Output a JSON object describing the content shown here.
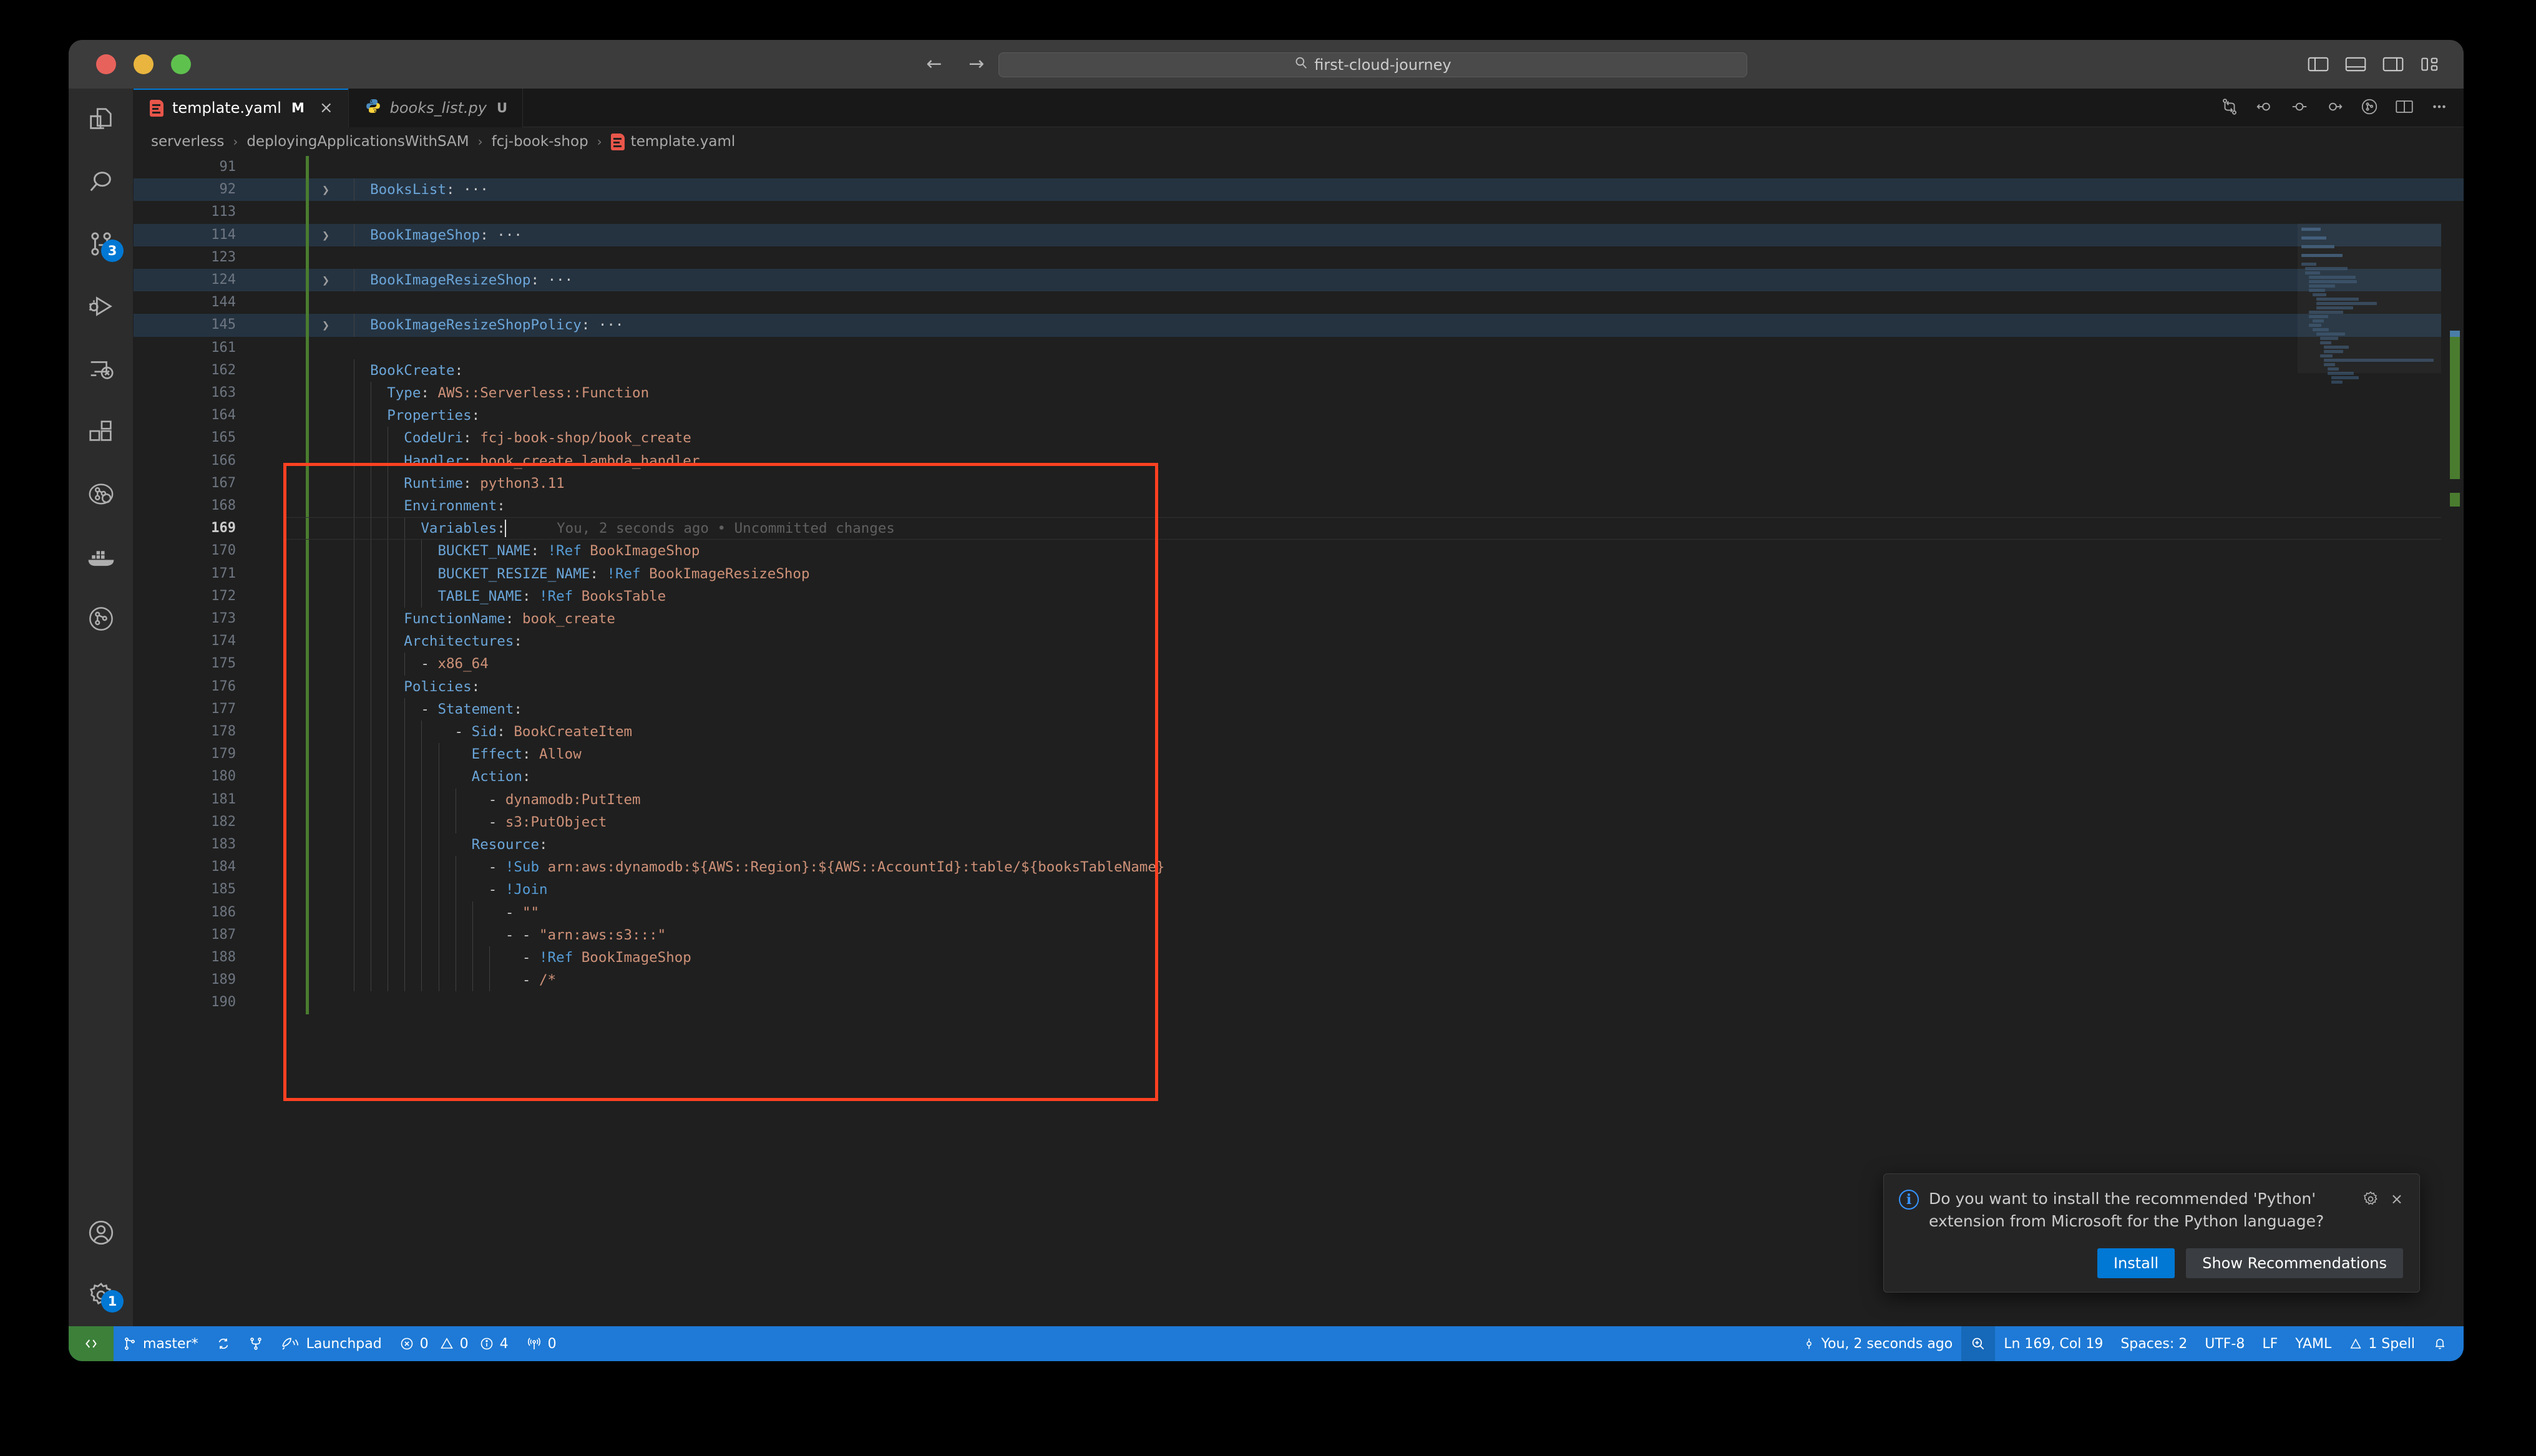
{
  "window": {
    "traffic_lights": [
      "close",
      "minimize",
      "maximize"
    ]
  },
  "titlebar": {
    "back_arrow": "←",
    "forward_arrow": "→",
    "search_icon": "⚲",
    "search_value": "first-cloud-journey",
    "layout_icons": [
      "toggle-primary-sidebar",
      "toggle-panel",
      "toggle-secondary-sidebar",
      "customize-layout"
    ]
  },
  "activitybar": {
    "items": [
      {
        "name": "explorer",
        "icon": "files-icon",
        "badge": ""
      },
      {
        "name": "search",
        "icon": "search-icon",
        "badge": ""
      },
      {
        "name": "source-control",
        "icon": "source-control-icon",
        "badge": "3"
      },
      {
        "name": "run-and-debug",
        "icon": "run-debug-icon",
        "badge": ""
      },
      {
        "name": "remote-explorer",
        "icon": "remote-explorer-icon",
        "badge": ""
      },
      {
        "name": "extensions",
        "icon": "extensions-icon",
        "badge": ""
      },
      {
        "name": "aws-toolkit",
        "icon": "aws-toolkit-icon",
        "badge": ""
      },
      {
        "name": "docker",
        "icon": "docker-icon",
        "badge": ""
      },
      {
        "name": "gitlens",
        "icon": "gitlens-icon",
        "badge": ""
      }
    ],
    "bottom_items": [
      {
        "name": "accounts",
        "icon": "account-icon",
        "badge": ""
      },
      {
        "name": "manage",
        "icon": "gear-icon",
        "badge": "1"
      }
    ]
  },
  "tabs": [
    {
      "label": "template.yaml",
      "state": "M",
      "icon": "yaml-file-icon",
      "active": true,
      "closable": true
    },
    {
      "label": "books_list.py",
      "state": "U",
      "icon": "python-file-icon",
      "active": false,
      "closable": false
    }
  ],
  "tab_actions": [
    "compare-changes-icon",
    "previous-change-icon",
    "toggle-change-icon",
    "next-change-icon",
    "gitlens-inspect-icon",
    "split-editor-icon",
    "more-actions-icon"
  ],
  "breadcrumb": {
    "separator": "›",
    "items": [
      {
        "label": "serverless"
      },
      {
        "label": "deployingApplicationsWithSAM"
      },
      {
        "label": "fcj-book-shop"
      },
      {
        "label": "template.yaml",
        "icon": "yaml-file-icon"
      }
    ]
  },
  "editor": {
    "blame_text": "You, 2 seconds ago • Uncommitted changes",
    "lines": [
      {
        "num": "91",
        "folded": false,
        "highlight": false,
        "indent": 0,
        "tokens": []
      },
      {
        "num": "92",
        "folded": true,
        "highlight": true,
        "indent": 1,
        "tokens": [
          {
            "t": "  ",
            "c": "p"
          },
          {
            "t": "BooksList",
            "c": "k"
          },
          {
            "t": ":",
            "c": "p"
          },
          {
            "t": " ···",
            "c": "p"
          }
        ]
      },
      {
        "num": "113",
        "folded": false,
        "highlight": false,
        "indent": 0,
        "tokens": []
      },
      {
        "num": "114",
        "folded": true,
        "highlight": true,
        "indent": 1,
        "tokens": [
          {
            "t": "  ",
            "c": "p"
          },
          {
            "t": "BookImageShop",
            "c": "k"
          },
          {
            "t": ":",
            "c": "p"
          },
          {
            "t": " ···",
            "c": "p"
          }
        ]
      },
      {
        "num": "123",
        "folded": false,
        "highlight": false,
        "indent": 0,
        "tokens": []
      },
      {
        "num": "124",
        "folded": true,
        "highlight": true,
        "indent": 1,
        "tokens": [
          {
            "t": "  ",
            "c": "p"
          },
          {
            "t": "BookImageResizeShop",
            "c": "k"
          },
          {
            "t": ":",
            "c": "p"
          },
          {
            "t": " ···",
            "c": "p"
          }
        ]
      },
      {
        "num": "144",
        "folded": false,
        "highlight": false,
        "indent": 0,
        "tokens": []
      },
      {
        "num": "145",
        "folded": true,
        "highlight": true,
        "indent": 1,
        "tokens": [
          {
            "t": "  ",
            "c": "p"
          },
          {
            "t": "BookImageResizeShopPolicy",
            "c": "k"
          },
          {
            "t": ":",
            "c": "p"
          },
          {
            "t": " ···",
            "c": "p"
          }
        ]
      },
      {
        "num": "161",
        "folded": false,
        "highlight": false,
        "indent": 0,
        "tokens": []
      },
      {
        "num": "162",
        "folded": false,
        "highlight": false,
        "indent": 1,
        "tokens": [
          {
            "t": "  ",
            "c": "p"
          },
          {
            "t": "BookCreate",
            "c": "k"
          },
          {
            "t": ":",
            "c": "p"
          }
        ]
      },
      {
        "num": "163",
        "folded": false,
        "highlight": false,
        "indent": 2,
        "tokens": [
          {
            "t": "    ",
            "c": "p"
          },
          {
            "t": "Type",
            "c": "k"
          },
          {
            "t": ": ",
            "c": "p"
          },
          {
            "t": "AWS::Serverless::Function",
            "c": "v"
          }
        ]
      },
      {
        "num": "164",
        "folded": false,
        "highlight": false,
        "indent": 2,
        "tokens": [
          {
            "t": "    ",
            "c": "p"
          },
          {
            "t": "Properties",
            "c": "k"
          },
          {
            "t": ":",
            "c": "p"
          }
        ]
      },
      {
        "num": "165",
        "folded": false,
        "highlight": false,
        "indent": 3,
        "tokens": [
          {
            "t": "      ",
            "c": "p"
          },
          {
            "t": "CodeUri",
            "c": "k"
          },
          {
            "t": ": ",
            "c": "p"
          },
          {
            "t": "fcj-book-shop/book_create",
            "c": "v"
          }
        ]
      },
      {
        "num": "166",
        "folded": false,
        "highlight": false,
        "indent": 3,
        "tokens": [
          {
            "t": "      ",
            "c": "p"
          },
          {
            "t": "Handler",
            "c": "k"
          },
          {
            "t": ": ",
            "c": "p"
          },
          {
            "t": "book_create.lambda_handler",
            "c": "v"
          }
        ]
      },
      {
        "num": "167",
        "folded": false,
        "highlight": false,
        "indent": 3,
        "tokens": [
          {
            "t": "      ",
            "c": "p"
          },
          {
            "t": "Runtime",
            "c": "k"
          },
          {
            "t": ": ",
            "c": "p"
          },
          {
            "t": "python3.11",
            "c": "v"
          }
        ]
      },
      {
        "num": "168",
        "folded": false,
        "highlight": false,
        "indent": 3,
        "tokens": [
          {
            "t": "      ",
            "c": "p"
          },
          {
            "t": "Environment",
            "c": "k"
          },
          {
            "t": ":",
            "c": "p"
          }
        ]
      },
      {
        "num": "169",
        "folded": false,
        "highlight": false,
        "current": true,
        "indent": 4,
        "tokens": [
          {
            "t": "        ",
            "c": "p"
          },
          {
            "t": "Variables",
            "c": "k"
          },
          {
            "t": ":",
            "c": "p"
          }
        ]
      },
      {
        "num": "170",
        "folded": false,
        "highlight": false,
        "indent": 5,
        "tokens": [
          {
            "t": "          ",
            "c": "p"
          },
          {
            "t": "BUCKET_NAME",
            "c": "k"
          },
          {
            "t": ": ",
            "c": "p"
          },
          {
            "t": "!Ref",
            "c": "tag"
          },
          {
            "t": " BookImageShop",
            "c": "v"
          }
        ]
      },
      {
        "num": "171",
        "folded": false,
        "highlight": false,
        "indent": 5,
        "tokens": [
          {
            "t": "          ",
            "c": "p"
          },
          {
            "t": "BUCKET_RESIZE_NAME",
            "c": "k"
          },
          {
            "t": ": ",
            "c": "p"
          },
          {
            "t": "!Ref",
            "c": "tag"
          },
          {
            "t": " BookImageResizeShop",
            "c": "v"
          }
        ]
      },
      {
        "num": "172",
        "folded": false,
        "highlight": false,
        "indent": 5,
        "tokens": [
          {
            "t": "          ",
            "c": "p"
          },
          {
            "t": "TABLE_NAME",
            "c": "k"
          },
          {
            "t": ": ",
            "c": "p"
          },
          {
            "t": "!Ref",
            "c": "tag"
          },
          {
            "t": " BooksTable",
            "c": "v"
          }
        ]
      },
      {
        "num": "173",
        "folded": false,
        "highlight": false,
        "indent": 3,
        "tokens": [
          {
            "t": "      ",
            "c": "p"
          },
          {
            "t": "FunctionName",
            "c": "k"
          },
          {
            "t": ": ",
            "c": "p"
          },
          {
            "t": "book_create",
            "c": "v"
          }
        ]
      },
      {
        "num": "174",
        "folded": false,
        "highlight": false,
        "indent": 3,
        "tokens": [
          {
            "t": "      ",
            "c": "p"
          },
          {
            "t": "Architectures",
            "c": "k"
          },
          {
            "t": ":",
            "c": "p"
          }
        ]
      },
      {
        "num": "175",
        "folded": false,
        "highlight": false,
        "indent": 4,
        "tokens": [
          {
            "t": "        - ",
            "c": "dash"
          },
          {
            "t": "x86_64",
            "c": "v"
          }
        ]
      },
      {
        "num": "176",
        "folded": false,
        "highlight": false,
        "indent": 3,
        "tokens": [
          {
            "t": "      ",
            "c": "p"
          },
          {
            "t": "Policies",
            "c": "k"
          },
          {
            "t": ":",
            "c": "p"
          }
        ]
      },
      {
        "num": "177",
        "folded": false,
        "highlight": false,
        "indent": 4,
        "tokens": [
          {
            "t": "        - ",
            "c": "dash"
          },
          {
            "t": "Statement",
            "c": "k"
          },
          {
            "t": ":",
            "c": "p"
          }
        ]
      },
      {
        "num": "178",
        "folded": false,
        "highlight": false,
        "indent": 5,
        "tokens": [
          {
            "t": "            - ",
            "c": "dash"
          },
          {
            "t": "Sid",
            "c": "k"
          },
          {
            "t": ": ",
            "c": "p"
          },
          {
            "t": "BookCreateItem",
            "c": "v"
          }
        ]
      },
      {
        "num": "179",
        "folded": false,
        "highlight": false,
        "indent": 6,
        "tokens": [
          {
            "t": "              ",
            "c": "p"
          },
          {
            "t": "Effect",
            "c": "k"
          },
          {
            "t": ": ",
            "c": "p"
          },
          {
            "t": "Allow",
            "c": "v"
          }
        ]
      },
      {
        "num": "180",
        "folded": false,
        "highlight": false,
        "indent": 6,
        "tokens": [
          {
            "t": "              ",
            "c": "p"
          },
          {
            "t": "Action",
            "c": "k"
          },
          {
            "t": ":",
            "c": "p"
          }
        ]
      },
      {
        "num": "181",
        "folded": false,
        "highlight": false,
        "indent": 7,
        "tokens": [
          {
            "t": "                - ",
            "c": "dash"
          },
          {
            "t": "dynamodb:PutItem",
            "c": "v"
          }
        ]
      },
      {
        "num": "182",
        "folded": false,
        "highlight": false,
        "indent": 7,
        "tokens": [
          {
            "t": "                - ",
            "c": "dash"
          },
          {
            "t": "s3:PutObject",
            "c": "v"
          }
        ]
      },
      {
        "num": "183",
        "folded": false,
        "highlight": false,
        "indent": 6,
        "tokens": [
          {
            "t": "              ",
            "c": "p"
          },
          {
            "t": "Resource",
            "c": "k"
          },
          {
            "t": ":",
            "c": "p"
          }
        ]
      },
      {
        "num": "184",
        "folded": false,
        "highlight": false,
        "indent": 7,
        "tokens": [
          {
            "t": "                - ",
            "c": "dash"
          },
          {
            "t": "!Sub",
            "c": "tag"
          },
          {
            "t": " arn:aws:dynamodb:${AWS::Region}:${AWS::AccountId}:table/${booksTableName}",
            "c": "v"
          }
        ]
      },
      {
        "num": "185",
        "folded": false,
        "highlight": false,
        "indent": 7,
        "tokens": [
          {
            "t": "                - ",
            "c": "dash"
          },
          {
            "t": "!Join",
            "c": "tag"
          }
        ]
      },
      {
        "num": "186",
        "folded": false,
        "highlight": false,
        "indent": 8,
        "tokens": [
          {
            "t": "                  - ",
            "c": "dash"
          },
          {
            "t": "\"\"",
            "c": "v"
          }
        ]
      },
      {
        "num": "187",
        "folded": false,
        "highlight": false,
        "indent": 8,
        "tokens": [
          {
            "t": "                  - - ",
            "c": "dash"
          },
          {
            "t": "\"arn:aws:s3:::\"",
            "c": "v"
          }
        ]
      },
      {
        "num": "188",
        "folded": false,
        "highlight": false,
        "indent": 9,
        "tokens": [
          {
            "t": "                    - ",
            "c": "dash"
          },
          {
            "t": "!Ref",
            "c": "tag"
          },
          {
            "t": " BookImageShop",
            "c": "v"
          }
        ]
      },
      {
        "num": "189",
        "folded": false,
        "highlight": false,
        "indent": 9,
        "tokens": [
          {
            "t": "                    - ",
            "c": "dash"
          },
          {
            "t": "/*",
            "c": "v"
          }
        ]
      },
      {
        "num": "190",
        "folded": false,
        "highlight": false,
        "indent": 0,
        "tokens": []
      }
    ]
  },
  "annotation": {
    "color": "#fc4122",
    "label": "highlight-box-book-create"
  },
  "toast": {
    "icon": "info-icon",
    "message": "Do you want to install the recommended 'Python' extension from Microsoft for the Python language?",
    "gear_icon": "gear-icon",
    "close_icon": "close-icon",
    "primary_button": "Install",
    "secondary_button": "Show Recommendations"
  },
  "statusbar": {
    "remote_icon": "remote-indicator-icon",
    "branch_icon": "source-control-icon",
    "branch": "master*",
    "sync_icon": "sync-icon",
    "fork_icon": "git-fork-icon",
    "launchpad_icon": "launchpad-icon",
    "launchpad": "Launchpad",
    "error_icon": "error-icon",
    "errors": "0",
    "warning_icon": "warning-icon",
    "warnings": "0",
    "info_icon": "info-icon",
    "infos": "4",
    "ports_icon": "radio-tower-icon",
    "ports": "0",
    "blame_icon": "git-commit-icon",
    "blame": "You, 2 seconds ago",
    "zoom_icon": "zoom-icon",
    "cursor_position": "Ln 169, Col 19",
    "indentation": "Spaces: 2",
    "encoding": "UTF-8",
    "eol": "LF",
    "language": "YAML",
    "spell_icon": "warning-icon",
    "spell": "1 Spell",
    "bell_icon": "bell-dot-icon"
  },
  "colors": {
    "accent": "#0078d4",
    "statusbar_bg": "#1e7ad6",
    "remote_bg": "#3c8039",
    "annotation_red": "#fc4122",
    "editor_bg": "#1f1f1f",
    "git_added": "#4a7c2f"
  }
}
